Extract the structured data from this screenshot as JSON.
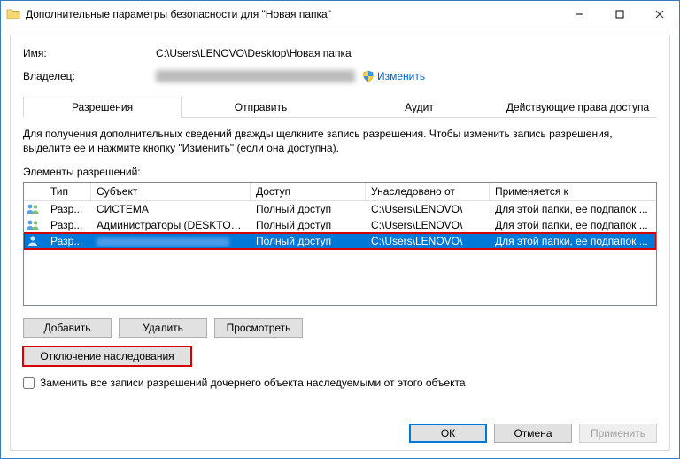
{
  "title": "Дополнительные параметры безопасности  для \"Новая папка\"",
  "info": {
    "name_label": "Имя:",
    "name_value": "C:\\Users\\LENOVO\\Desktop\\Новая папка",
    "owner_label": "Владелец:",
    "change_link": "Изменить"
  },
  "tabs": {
    "permissions": "Разрешения",
    "share": "Отправить",
    "audit": "Аудит",
    "effective": "Действующие права доступа"
  },
  "desc": "Для получения дополнительных сведений дважды щелкните запись разрешения. Чтобы изменить запись разрешения, выделите ее и нажмите кнопку \"Изменить\" (если она доступна).",
  "elements_label": "Элементы разрешений:",
  "columns": {
    "type": "Тип",
    "subject": "Субъект",
    "access": "Доступ",
    "inherited": "Унаследовано от",
    "applies": "Применяется к"
  },
  "rows": [
    {
      "type": "Разр...",
      "subject": "СИСТЕМА",
      "access": "Полный доступ",
      "inherited": "C:\\Users\\LENOVO\\",
      "applies": "Для этой папки, ее подпапок ..."
    },
    {
      "type": "Разр...",
      "subject": "Администраторы (DESKTOP-...",
      "access": "Полный доступ",
      "inherited": "C:\\Users\\LENOVO\\",
      "applies": "Для этой папки, ее подпапок ..."
    },
    {
      "type": "Разр...",
      "subject": "",
      "access": "Полный доступ",
      "inherited": "C:\\Users\\LENOVO\\",
      "applies": "Для этой папки, ее подпапок ..."
    }
  ],
  "buttons": {
    "add": "Добавить",
    "remove": "Удалить",
    "view": "Просмотреть",
    "disable_inherit": "Отключение наследования",
    "ok": "ОК",
    "cancel": "Отмена",
    "apply": "Применить"
  },
  "checkbox_label": "Заменить все записи разрешений дочернего объекта наследуемыми от этого объекта"
}
